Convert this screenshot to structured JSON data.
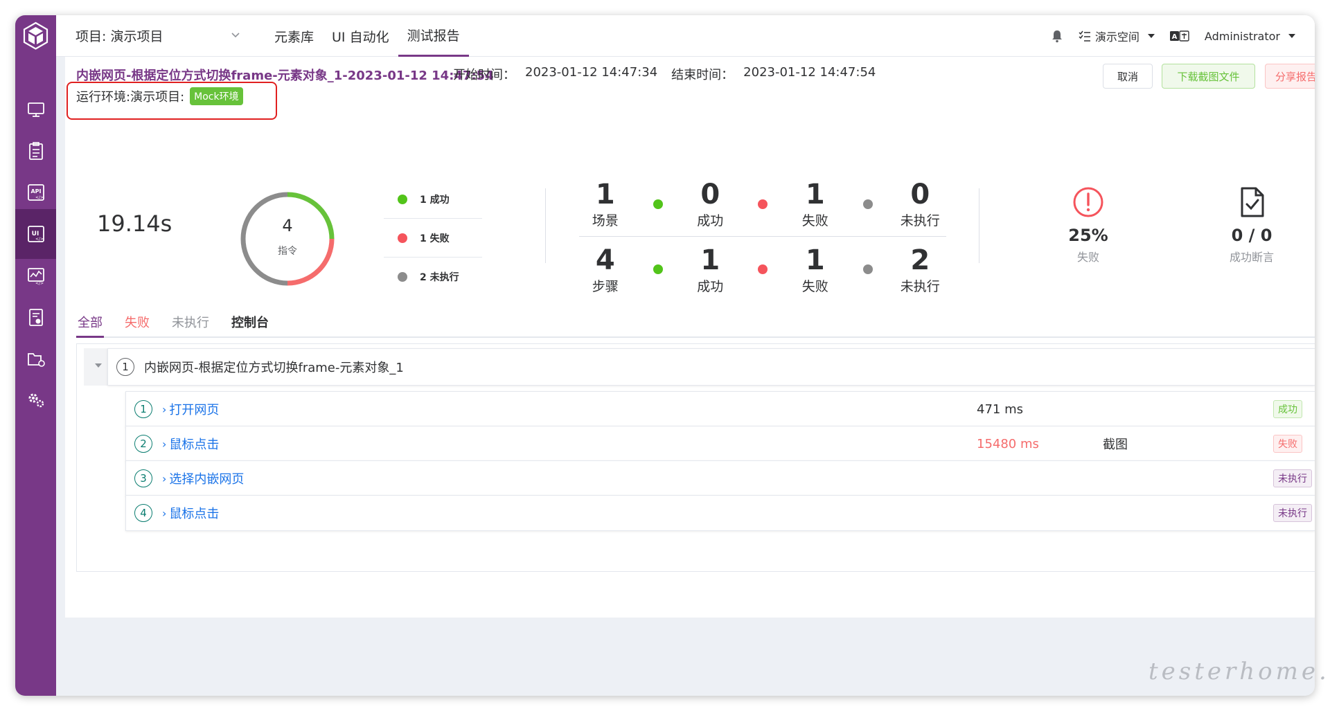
{
  "header": {
    "project_label": "项目: 演示项目",
    "nav": [
      "元素库",
      "UI 自动化",
      "测试报告"
    ],
    "workspace": "演示空间",
    "user": "Administrator"
  },
  "report": {
    "title": "内嵌网页-根据定位方式切换frame-元素对象_1-2023-01-12 14:47:54",
    "start_label": "开始时间：",
    "start_time": "2023-01-12 14:47:34",
    "end_label": "结束时间：",
    "end_time": "2023-01-12 14:47:54",
    "env_label": "运行环境:演示项目:",
    "env_tag": "Mock环境",
    "buttons": {
      "cancel": "取消",
      "download": "下载截图文件",
      "share": "分享报告"
    }
  },
  "stats": {
    "duration": "19.14s",
    "donut": {
      "total": "4",
      "label": "指令",
      "success": 1,
      "fail": 1,
      "pending": 2
    },
    "legend": [
      "1 成功",
      "1 失败",
      "2 未执行"
    ],
    "scenario": {
      "total": "1",
      "total_label": "场景",
      "success": "0",
      "success_label": "成功",
      "fail": "1",
      "fail_label": "失败",
      "pending": "0",
      "pending_label": "未执行"
    },
    "steps": {
      "total": "4",
      "total_label": "步骤",
      "success": "1",
      "success_label": "成功",
      "fail": "1",
      "fail_label": "失败",
      "pending": "2",
      "pending_label": "未执行"
    },
    "fail_rate": "25%",
    "fail_rate_label": "失败",
    "assert_value": "0 / 0",
    "assert_label": "成功断言"
  },
  "tabs": [
    "全部",
    "失败",
    "未执行",
    "控制台"
  ],
  "scenario_row": {
    "index": "1",
    "name": "内嵌网页-根据定位方式切换frame-元素对象_1"
  },
  "steps": [
    {
      "index": "1",
      "name": "打开网页",
      "time": "471 ms",
      "shot": "",
      "status": "成功"
    },
    {
      "index": "2",
      "name": "鼠标点击",
      "time": "15480 ms",
      "shot": "截图",
      "status": "失败"
    },
    {
      "index": "3",
      "name": "选择内嵌网页",
      "time": "",
      "shot": "",
      "status": "未执行"
    },
    {
      "index": "4",
      "name": "鼠标点击",
      "time": "",
      "shot": "",
      "status": "未执行"
    }
  ],
  "watermark": "testerhome.com",
  "colors": {
    "brand": "#783887",
    "success": "#67c23a",
    "fail": "#f56c6c",
    "pending": "#8c8c8c"
  }
}
